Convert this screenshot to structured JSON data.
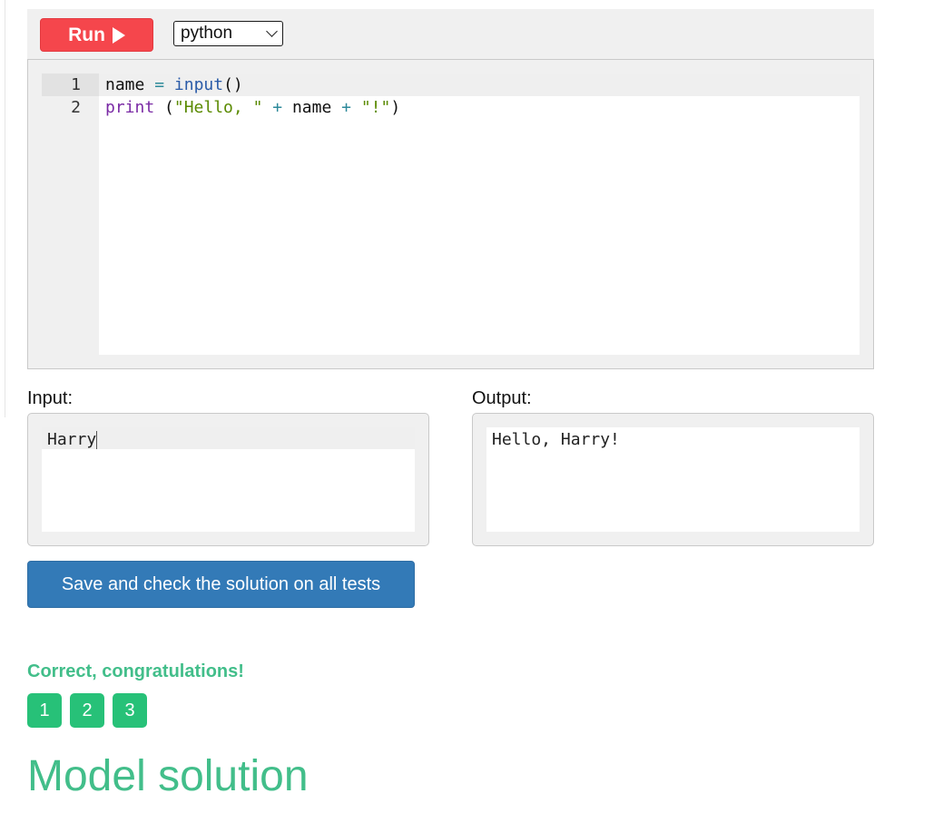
{
  "toolbar": {
    "run_label": "Run",
    "language": "python"
  },
  "editor": {
    "lines": [
      {
        "number": "1",
        "tokens": [
          {
            "text": "name",
            "kind": "var"
          },
          {
            "text": " ",
            "kind": "var"
          },
          {
            "text": "=",
            "kind": "op"
          },
          {
            "text": " ",
            "kind": "var"
          },
          {
            "text": "input",
            "kind": "builtin"
          },
          {
            "text": "()",
            "kind": "punct"
          }
        ]
      },
      {
        "number": "2",
        "tokens": [
          {
            "text": "print",
            "kind": "keyword"
          },
          {
            "text": " (",
            "kind": "punct"
          },
          {
            "text": "\"Hello, \"",
            "kind": "string"
          },
          {
            "text": " ",
            "kind": "var"
          },
          {
            "text": "+",
            "kind": "op"
          },
          {
            "text": " name ",
            "kind": "var"
          },
          {
            "text": "+",
            "kind": "op"
          },
          {
            "text": " ",
            "kind": "var"
          },
          {
            "text": "\"!\"",
            "kind": "string"
          },
          {
            "text": ")",
            "kind": "punct"
          }
        ]
      }
    ]
  },
  "io": {
    "input_label": "Input:",
    "input_value": "Harry",
    "output_label": "Output:",
    "output_value": "Hello, Harry!"
  },
  "save_button_label": "Save and check the solution on all tests",
  "result": {
    "message": "Correct, congratulations!",
    "tests": [
      "1",
      "2",
      "3"
    ]
  },
  "model_solution_heading": "Model solution",
  "colors": {
    "run_button": "#f5464c",
    "save_button": "#337ab7",
    "success": "#42be8a",
    "test_badge": "#27c178"
  }
}
